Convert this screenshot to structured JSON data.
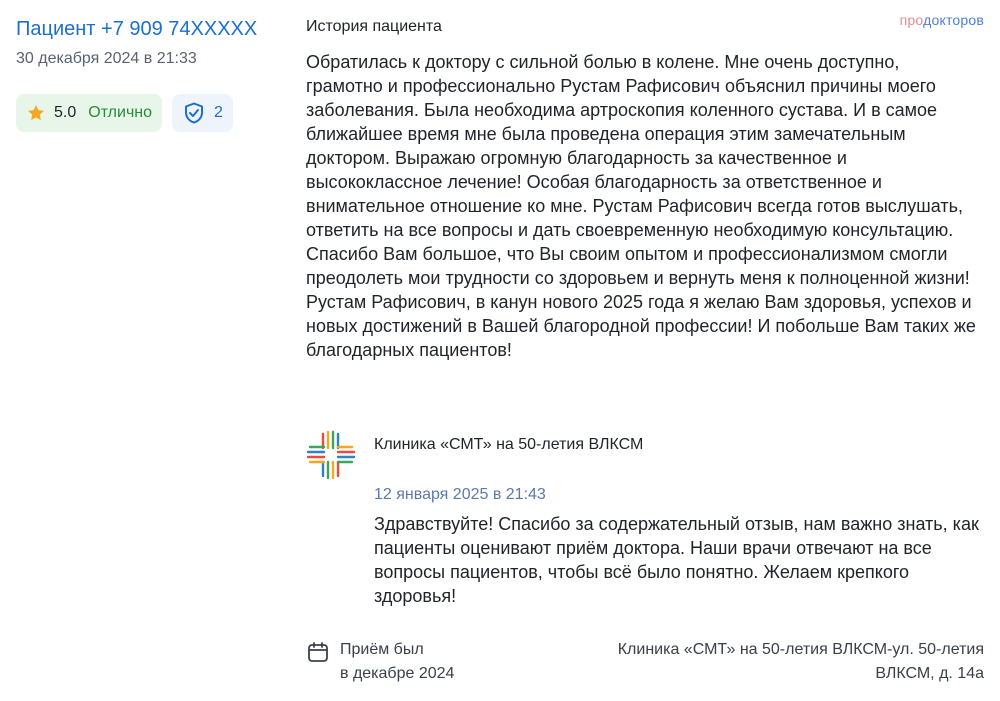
{
  "author": {
    "name": "Пациент +7 909 74XXXXX",
    "date": "30 декабря 2024 в 21:33"
  },
  "rating": {
    "score": "5.0",
    "word": "Отлично"
  },
  "verification": {
    "count": "2"
  },
  "brand": {
    "pro": "про",
    "doctorov": "докторов"
  },
  "section": {
    "title": "История пациента"
  },
  "review": {
    "text": "Обратилась к доктору с сильной болью в колене. Мне очень доступно, грамотно и профессионально Рустам Рафисович объяснил причины моего заболевания. Была необходима артроскопия коленного сустава. И в самое ближайшее время мне была проведена операция этим замечательным доктором. Выражаю огромную благодарность за качественное и высококлассное лечение! Особая благодарность за ответственное и внимательное отношение ко мне. Рустам Рафисович всегда готов выслушать, ответить на все вопросы и дать своевременную необходимую консультацию. Спасибо Вам большое, что Вы своим опытом и профессионализмом смогли преодолеть мои трудности со здоровьем и вернуть меня к полноценной жизни! Рустам Рафисович, в канун нового 2025 года я желаю Вам здоровья, успехов и новых достижений в Вашей благородной профессии! И побольше Вам таких же благодарных пациентов!"
  },
  "reply": {
    "clinic": "Клиника «СМТ» на 50-летия ВЛКСМ",
    "date": "12 января 2025 в 21:43",
    "text": "Здравствуйте! Спасибо за содержательный отзыв, нам важно знать, как пациенты оценивают приём доктора. Наши врачи отвечают на все вопросы пациентов, чтобы всё было понятно. Желаем крепкого здоровья!"
  },
  "footer": {
    "visit_line1": "Приём был",
    "visit_line2": "в декабре 2024",
    "address": "Клиника «СМТ» на 50-летия ВЛКСМ-ул. 50-летия ВЛКСМ, д. 14а"
  },
  "colors": {
    "link": "#1a6fd1",
    "rating_bg": "#e8f6ea",
    "rating_text": "#2a8a3a",
    "star": "#f5a623"
  }
}
